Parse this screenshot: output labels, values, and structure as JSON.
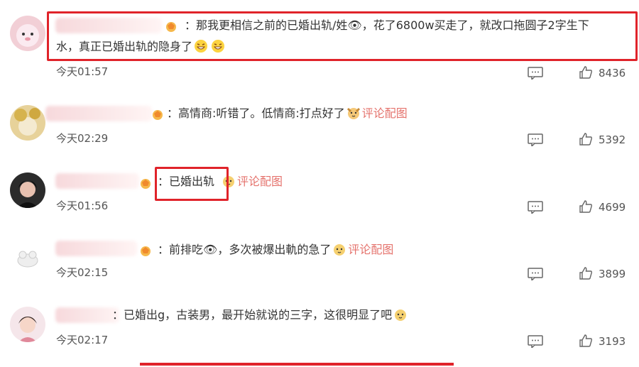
{
  "comments": [
    {
      "text_line1": "：那我更相信之前的已婚出轨/姓",
      "text_line1b": "，花了6800w买走了，就改口拖圆子2字生下",
      "text_line2": "水，真正已婚出轨的隐身了",
      "time": "今天01:57",
      "likes": "8436",
      "highlighted": true
    },
    {
      "text": "：高情商:听错了。低情商:打点好了",
      "pic_link": "评论配图",
      "time": "今天02:29",
      "likes": "5392"
    },
    {
      "text": "：已婚出轨",
      "pic_link": "评论配图",
      "time": "今天01:56",
      "likes": "4699",
      "highlighted": true
    },
    {
      "text": "：前排吃",
      "text_b": "，多次被爆出軌的急了",
      "pic_link": "评论配图",
      "time": "今天02:15",
      "likes": "3899"
    },
    {
      "text": "：已婚出g，古装男，最开始就说的三字，这很明显了吧",
      "time": "今天02:17",
      "likes": "3193"
    }
  ],
  "colors": {
    "highlight": "#e0232a",
    "link": "#e5736d"
  }
}
